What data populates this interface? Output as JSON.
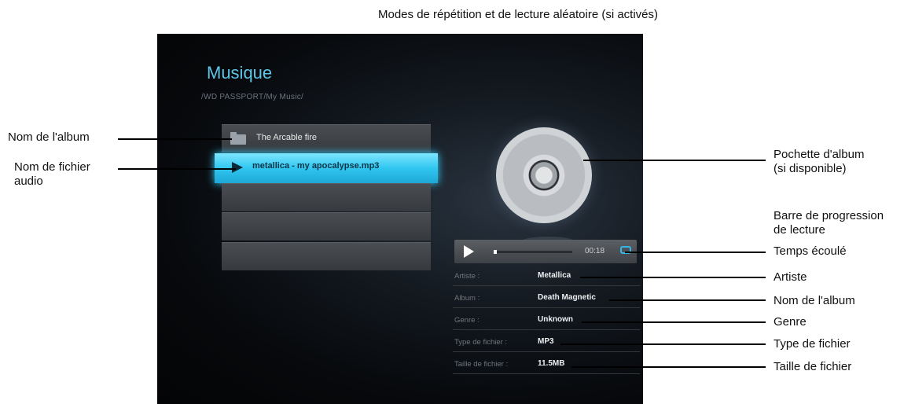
{
  "screen": {
    "title": "Musique",
    "path": "/WD PASSPORT/My Music/",
    "list": [
      {
        "type": "folder",
        "icon": "folder-icon",
        "label": "The Arcable fire"
      },
      {
        "type": "audio",
        "icon": "play-icon",
        "label": "metallica - my apocalypse.mp3",
        "selected": true
      },
      {
        "type": "empty",
        "label": ""
      },
      {
        "type": "empty",
        "label": ""
      },
      {
        "type": "empty",
        "label": ""
      }
    ],
    "player": {
      "play_icon": "play-icon",
      "progress_fraction": 0.04,
      "elapsed": "00:18",
      "repeat_icon": "repeat-icon"
    },
    "info": [
      {
        "label": "Artiste :",
        "value": "Metallica"
      },
      {
        "label": "Album :",
        "value": "Death Magnetic"
      },
      {
        "label": "Genre :",
        "value": "Unknown"
      },
      {
        "label": "Type de fichier :",
        "value": "MP3"
      },
      {
        "label": "Taille de fichier :",
        "value": "11.5MB"
      }
    ],
    "colors": {
      "accent": "#30c6f0",
      "title": "#5ec6e8"
    }
  },
  "callouts": {
    "modes": "Modes de répétition et de lecture aléatoire (si activés)",
    "album_name_left": "Nom de l'album",
    "audio_file_line1": "Nom de fichier",
    "audio_file_line2": "audio",
    "cover_line1": "Pochette d'album",
    "cover_line2": "(si disponible)",
    "progress_line1": "Barre de progression",
    "progress_line2": "de lecture",
    "elapsed": "Temps écoulé",
    "artist": "Artiste",
    "album_name_right": "Nom de l'album",
    "genre": "Genre",
    "file_type": "Type de fichier",
    "file_size": "Taille de fichier"
  }
}
